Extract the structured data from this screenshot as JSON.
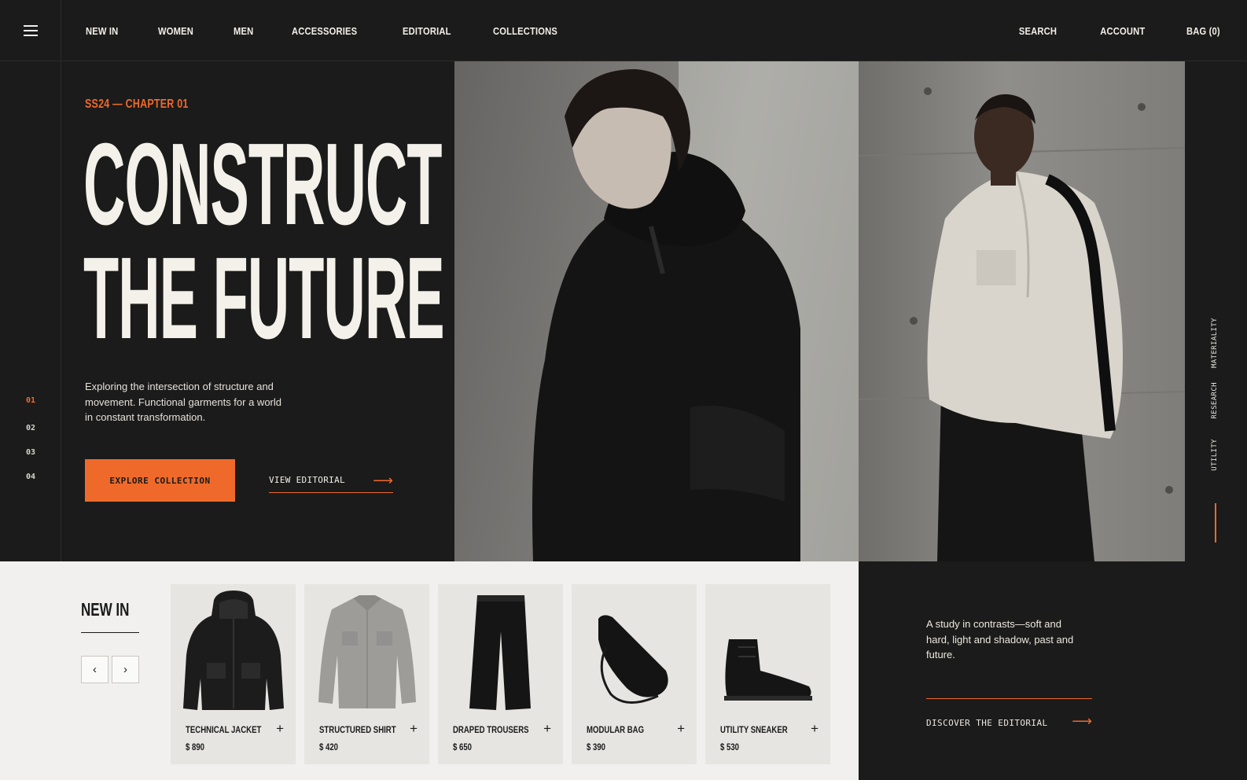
{
  "nav": {
    "left": [
      "NEW IN",
      "WOMEN",
      "MEN",
      "ACCESSORIES",
      "EDITORIAL",
      "COLLECTIONS"
    ],
    "right": {
      "search": "SEARCH",
      "account": "ACCOUNT",
      "bag": "BAG (0)"
    }
  },
  "slides": [
    "01",
    "02",
    "03",
    "04"
  ],
  "hero": {
    "eyebrow": "SS24 — CHAPTER 01",
    "headline_line1": "CONSTRUCT",
    "headline_line2": "THE FUTURE",
    "lede": "Exploring the intersection of structure and movement. Functional garments for a world in constant transformation.",
    "cta_primary": "EXPLORE COLLECTION",
    "cta_secondary": "VIEW EDITORIAL"
  },
  "side_labels": [
    "MATERIALITY",
    "RESEARCH",
    "UTILITY"
  ],
  "new_in": {
    "title": "NEW IN",
    "prev": "‹",
    "next": "›",
    "products": [
      {
        "name": "TECHNICAL JACKET",
        "price": "$ 890",
        "icon": "jacket-icon"
      },
      {
        "name": "STRUCTURED SHIRT",
        "price": "$ 420",
        "icon": "shirt-icon"
      },
      {
        "name": "DRAPED TROUSERS",
        "price": "$ 650",
        "icon": "trousers-icon"
      },
      {
        "name": "MODULAR BAG",
        "price": "$ 390",
        "icon": "bag-icon"
      },
      {
        "name": "UTILITY SNEAKER",
        "price": "$ 530",
        "icon": "sneaker-icon"
      }
    ]
  },
  "editorial": {
    "quote": "A study in contrasts—soft and hard, light and shadow, past and future.",
    "link": "DISCOVER THE EDITORIAL"
  },
  "colors": {
    "accent": "#ef6a2a",
    "dark": "#1b1b1b",
    "light": "#f1f0ee"
  }
}
